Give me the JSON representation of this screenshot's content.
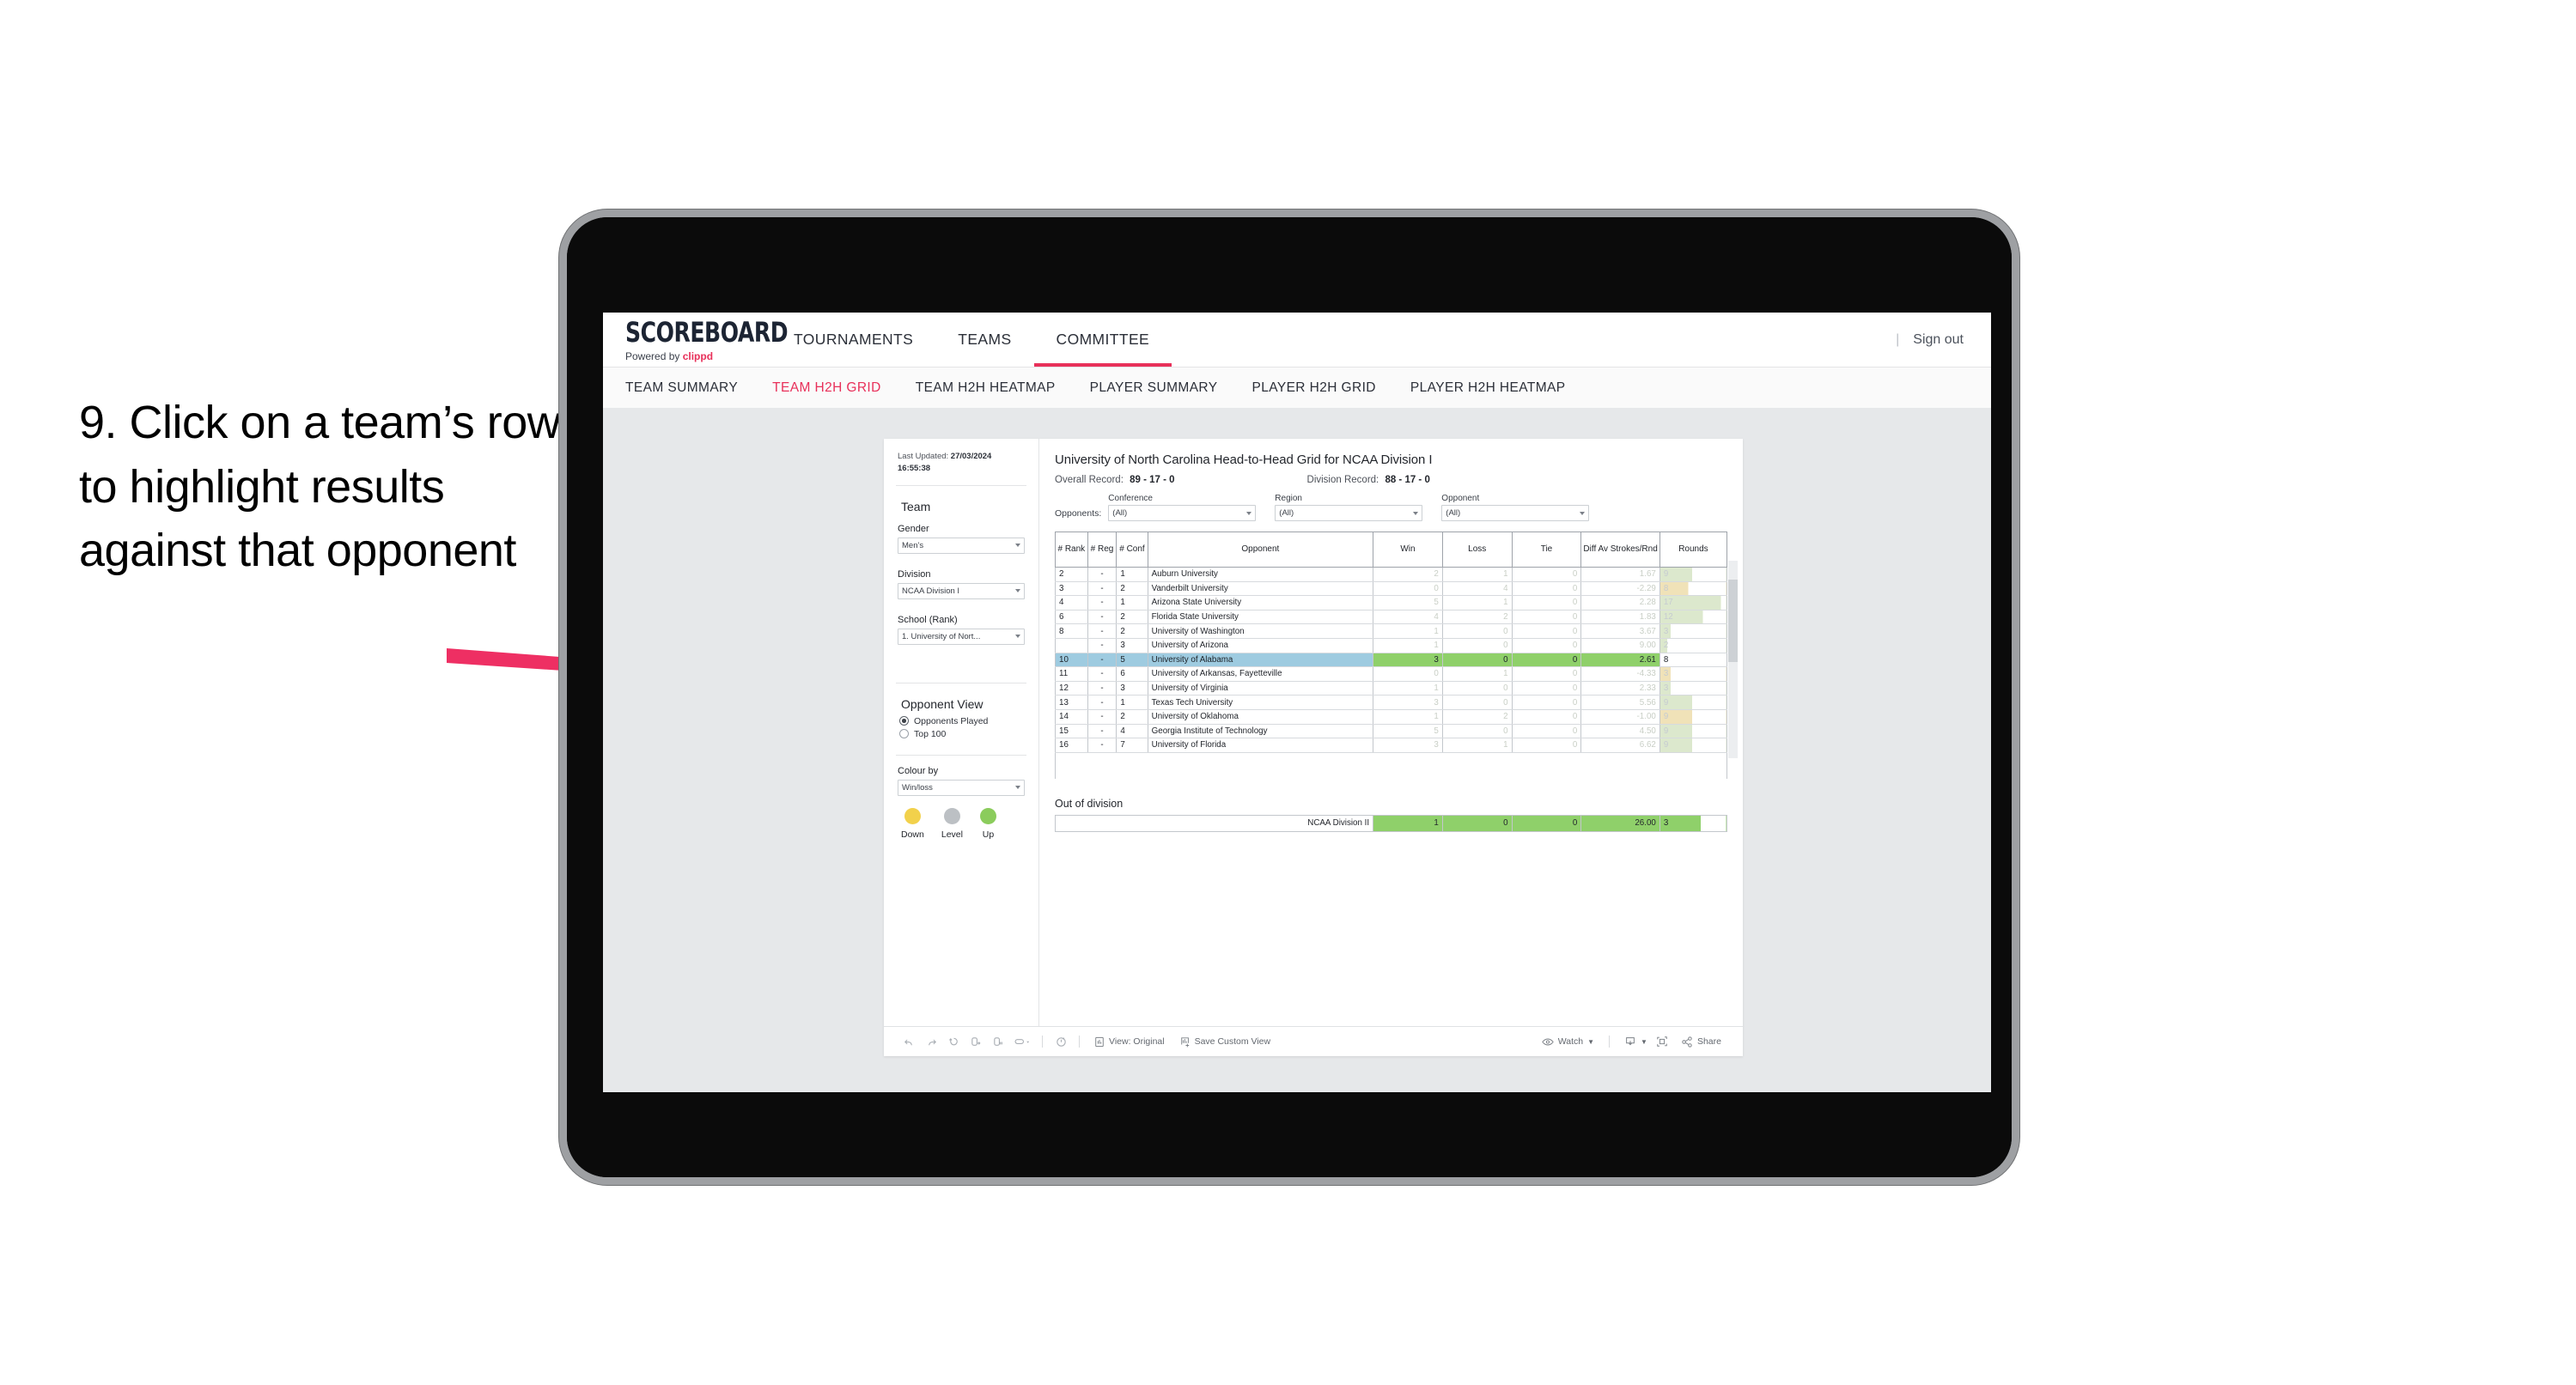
{
  "annotation": {
    "text": "9. Click on a team’s row to highlight results against that opponent"
  },
  "header": {
    "logo_word": "SCOREBOARD",
    "logo_powered_prefix": "Powered by ",
    "logo_brand": "clippd",
    "nav": [
      {
        "label": "TOURNAMENTS",
        "active": false
      },
      {
        "label": "TEAMS",
        "active": false
      },
      {
        "label": "COMMITTEE",
        "active": true
      }
    ],
    "divider": "|",
    "signout": "Sign out",
    "accent_color": "#e8305a"
  },
  "subtabs": [
    {
      "label": "TEAM SUMMARY",
      "active": false
    },
    {
      "label": "TEAM H2H GRID",
      "active": true
    },
    {
      "label": "TEAM H2H HEATMAP",
      "active": false
    },
    {
      "label": "PLAYER SUMMARY",
      "active": false
    },
    {
      "label": "PLAYER H2H GRID",
      "active": false
    },
    {
      "label": "PLAYER H2H HEATMAP",
      "active": false
    }
  ],
  "sidebar": {
    "last_updated_label": "Last Updated: ",
    "last_updated_value": "27/03/2024 16:55:38",
    "team_heading": "Team",
    "gender_label": "Gender",
    "gender_value": "Men’s",
    "division_label": "Division",
    "division_value": "NCAA Division I",
    "school_label": "School (Rank)",
    "school_value": "1. University of Nort...",
    "opponent_view_heading": "Opponent View",
    "opponent_view_options": [
      {
        "label": "Opponents Played",
        "selected": true
      },
      {
        "label": "Top 100",
        "selected": false
      }
    ],
    "colour_by_label": "Colour by",
    "colour_by_value": "Win/loss",
    "legend": [
      {
        "label": "Down",
        "color": "#f2d14b"
      },
      {
        "label": "Level",
        "color": "#bcc0c4"
      },
      {
        "label": "Up",
        "color": "#8bcc5c"
      }
    ]
  },
  "main": {
    "title": "University of North Carolina Head-to-Head Grid for NCAA Division I",
    "overall_record_label": "Overall Record: ",
    "overall_record_value": "89 - 17 - 0",
    "division_record_label": "Division Record: ",
    "division_record_value": "88 - 17 - 0",
    "opponents_label": "Opponents:",
    "filters": [
      {
        "label": "Conference",
        "value": "(All)"
      },
      {
        "label": "Region",
        "value": "(All)"
      },
      {
        "label": "Opponent",
        "value": "(All)"
      }
    ]
  },
  "chart_data": {
    "type": "table",
    "title": "University of North Carolina Head-to-Head Grid for NCAA Division I",
    "columns": [
      "# Rank",
      "# Reg",
      "# Conf",
      "Opponent",
      "Win",
      "Loss",
      "Tie",
      "Diff Av Strokes/Rnd",
      "Rounds"
    ],
    "rows": [
      {
        "rank": "2",
        "reg": "-",
        "conf": "1",
        "opponent": "Auburn University",
        "win": "2",
        "loss": "1",
        "tie": "0",
        "diff": "1.67",
        "rounds": "9",
        "tone": "win",
        "selected": false
      },
      {
        "rank": "3",
        "reg": "-",
        "conf": "2",
        "opponent": "Vanderbilt University",
        "win": "0",
        "loss": "4",
        "tie": "0",
        "diff": "-2.29",
        "rounds": "8",
        "tone": "loss",
        "selected": false
      },
      {
        "rank": "4",
        "reg": "-",
        "conf": "1",
        "opponent": "Arizona State University",
        "win": "5",
        "loss": "1",
        "tie": "0",
        "diff": "2.28",
        "rounds": "17",
        "tone": "win",
        "selected": false
      },
      {
        "rank": "6",
        "reg": "-",
        "conf": "2",
        "opponent": "Florida State University",
        "win": "4",
        "loss": "2",
        "tie": "0",
        "diff": "1.83",
        "rounds": "12",
        "tone": "win",
        "selected": false
      },
      {
        "rank": "8",
        "reg": "-",
        "conf": "2",
        "opponent": "University of Washington",
        "win": "1",
        "loss": "0",
        "tie": "0",
        "diff": "3.67",
        "rounds": "3",
        "tone": "win",
        "selected": false
      },
      {
        "rank": "",
        "reg": "-",
        "conf": "3",
        "opponent": "University of Arizona",
        "win": "1",
        "loss": "0",
        "tie": "0",
        "diff": "9.00",
        "rounds": "2",
        "tone": "win",
        "selected": false
      },
      {
        "rank": "10",
        "reg": "-",
        "conf": "5",
        "opponent": "University of Alabama",
        "win": "3",
        "loss": "0",
        "tie": "0",
        "diff": "2.61",
        "rounds": "8",
        "tone": "win",
        "selected": true
      },
      {
        "rank": "11",
        "reg": "-",
        "conf": "6",
        "opponent": "University of Arkansas, Fayetteville",
        "win": "0",
        "loss": "1",
        "tie": "0",
        "diff": "-4.33",
        "rounds": "3",
        "tone": "loss",
        "selected": false
      },
      {
        "rank": "12",
        "reg": "-",
        "conf": "3",
        "opponent": "University of Virginia",
        "win": "1",
        "loss": "0",
        "tie": "0",
        "diff": "2.33",
        "rounds": "3",
        "tone": "win",
        "selected": false
      },
      {
        "rank": "13",
        "reg": "-",
        "conf": "1",
        "opponent": "Texas Tech University",
        "win": "3",
        "loss": "0",
        "tie": "0",
        "diff": "5.56",
        "rounds": "9",
        "tone": "win",
        "selected": false
      },
      {
        "rank": "14",
        "reg": "-",
        "conf": "2",
        "opponent": "University of Oklahoma",
        "win": "1",
        "loss": "2",
        "tie": "0",
        "diff": "-1.00",
        "rounds": "9",
        "tone": "loss",
        "selected": false
      },
      {
        "rank": "15",
        "reg": "-",
        "conf": "4",
        "opponent": "Georgia Institute of Technology",
        "win": "5",
        "loss": "0",
        "tie": "0",
        "diff": "4.50",
        "rounds": "9",
        "tone": "win",
        "selected": false
      },
      {
        "rank": "16",
        "reg": "-",
        "conf": "7",
        "opponent": "University of Florida",
        "win": "3",
        "loss": "1",
        "tie": "0",
        "diff": "6.62",
        "rounds": "9",
        "tone": "win",
        "selected": false
      }
    ],
    "out_of_division": {
      "title": "Out of division",
      "name": "NCAA Division II",
      "win": "1",
      "loss": "0",
      "tie": "0",
      "diff": "26.00",
      "rounds": "3"
    }
  },
  "toolbar": {
    "undo": "undo-icon",
    "redo": "redo-icon",
    "revert": "revert-icon",
    "refresh": "refresh-icon",
    "pause": "pause-icon",
    "view_original": "View: Original",
    "save_custom_view": "Save Custom View",
    "watch": "Watch",
    "share": "Share"
  }
}
